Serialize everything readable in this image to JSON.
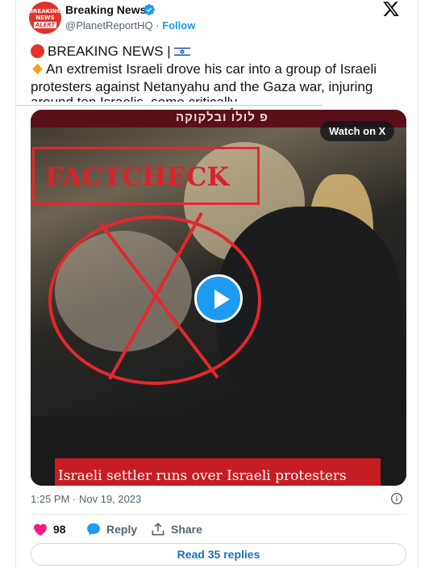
{
  "author": {
    "name": "Breaking News",
    "handle": "@PlanetReportHQ",
    "separator": "·",
    "follow_label": "Follow",
    "avatar_lines": [
      "BREAKING",
      "NEWS",
      "ALERT"
    ]
  },
  "post": {
    "line1": "BREAKING NEWS |",
    "line2": "An extremist Israeli drove his car into a group of Israeli",
    "line3": "protesters against Netanyahu and the Gaza war, injuring",
    "line4": "around ten Israelis, some critically..."
  },
  "media": {
    "watch_label": "Watch on X",
    "overlay_label": "FACTCHECK",
    "banner_text": "פ לולו ובלקוקה",
    "caption": "Israeli settler runs over Israeli protesters"
  },
  "meta": {
    "timestamp": "1:25 PM · Nov 19, 2023"
  },
  "actions": {
    "likes": "98",
    "reply_label": "Reply",
    "share_label": "Share"
  },
  "read_replies_label": "Read 35 replies",
  "colors": {
    "accent": "#1d9bf0",
    "like": "#f91880",
    "factcheck": "#e3282d",
    "caption_bg": "#c51d23"
  },
  "icons": [
    "verified-icon",
    "x-logo-icon",
    "red-circle-icon",
    "israel-flag-icon",
    "diamond-icon",
    "play-icon",
    "info-icon",
    "heart-icon",
    "reply-icon",
    "share-icon"
  ]
}
